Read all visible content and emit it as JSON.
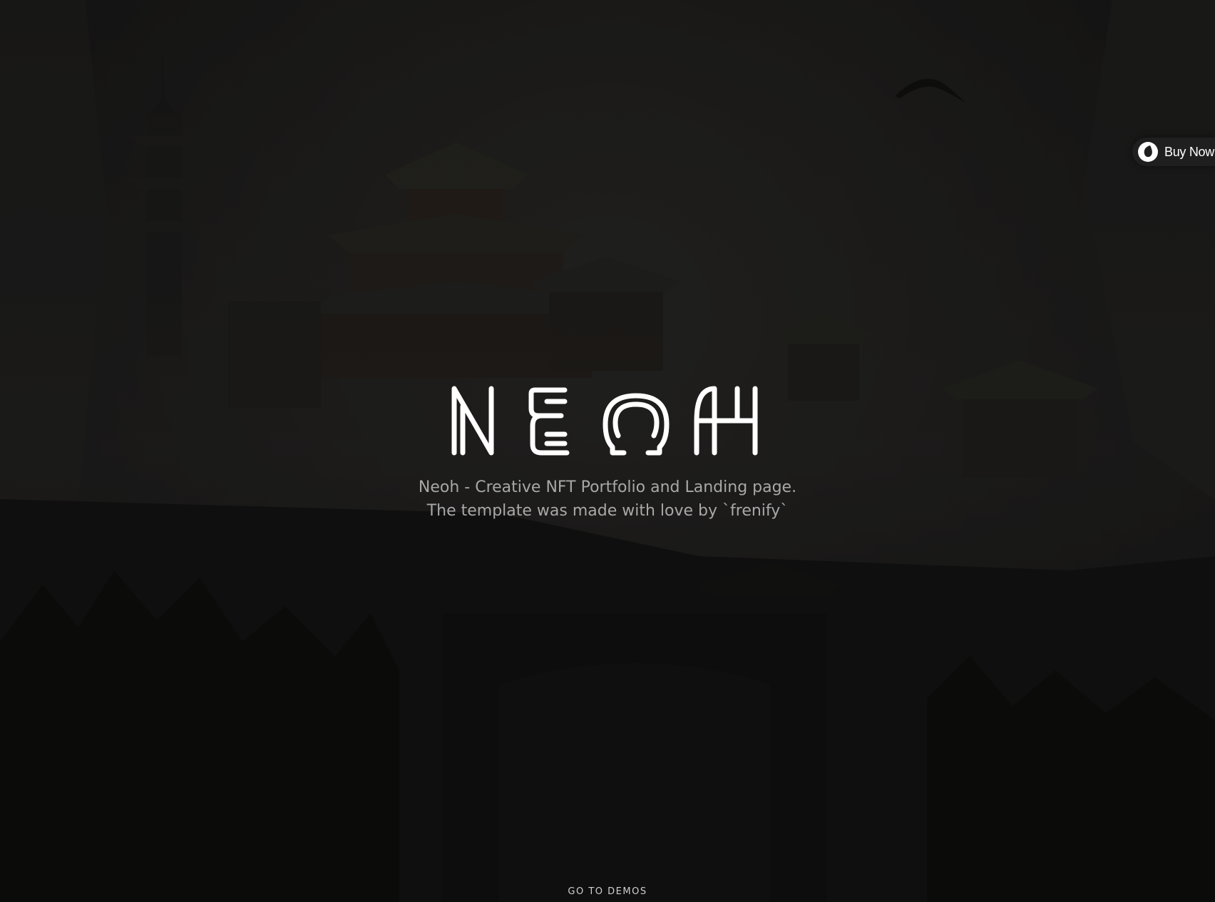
{
  "brand": {
    "logo_text": "NEOH"
  },
  "hero": {
    "tagline_line1": "Neoh - Creative NFT Portfolio and Landing page.",
    "tagline_line2": "The template was made with love by `frenify`"
  },
  "buy_button": {
    "label": "Buy Now",
    "icon": "envato-leaf-icon"
  },
  "footer": {
    "go_to_demos": "GO TO DEMOS"
  },
  "colors": {
    "background": "#141414",
    "logo": "#ffffff",
    "tagline": "#a8a8a8",
    "button_bg": "#1f1f1f"
  }
}
